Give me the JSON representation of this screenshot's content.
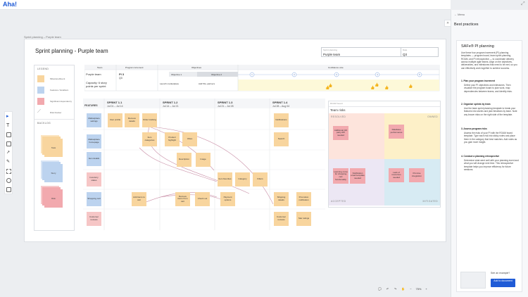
{
  "app": {
    "logo": "Aha!",
    "expand_icon": "expand-icon"
  },
  "breadcrumb": "Sprint planning – Purple team",
  "board": {
    "title": "Sprint planning - Purple team",
    "fields": [
      {
        "label": "Sprint planning",
        "value": "Purple team"
      },
      {
        "label": "Date",
        "value": "Q3"
      }
    ]
  },
  "legend": {
    "heading": "LEGEND",
    "items": [
      "Milestone/Event",
      "Features / Enablers",
      "Significant dependency",
      "Risk blocker"
    ],
    "backlog_heading": "BACKLOG",
    "backlog": [
      "Task",
      "Story",
      "Risk"
    ]
  },
  "pi_table": {
    "team_hdr": "Team",
    "inc_hdr": "Program increment",
    "obj_hdr": "Objectives",
    "conf_hdr": "Confidence vote",
    "team": "Purple team",
    "pi": "PI 3",
    "pi_sub": "Q3",
    "capacity": "Capacity: 6 story points per sprint",
    "obj1": "Objective 1",
    "obj2": "Objective 2",
    "obj1_text": "Launch marketplace",
    "obj2_text": "Add 50+ partners",
    "votes": [
      "1",
      "2",
      "3",
      "4",
      "5"
    ]
  },
  "features_label": "FEATURES",
  "sprints": [
    {
      "name": "SPRINT 1.1",
      "dates": "Jul 01 – Jul 14"
    },
    {
      "name": "SPRINT 1.2",
      "dates": "Jul 14 – Jul 21"
    },
    {
      "name": "SPRINT 1.3",
      "dates": "Jul 21 – Jul 28"
    },
    {
      "name": "SPRINT 1.4",
      "dates": "Jul 28 – Aug 04"
    }
  ],
  "features": [
    "Marketplace settings",
    "Marketplace homepage",
    "Item details",
    "Inventory status",
    "Shopping cart",
    "Customer reviews"
  ],
  "stickies": [
    "User profile",
    "Remove details",
    "Order tracking",
    "Notifications",
    "Item categories",
    "Product highlight",
    "Video",
    "Search",
    "Description",
    "Image",
    "Item favorites",
    "Category",
    "Filters",
    "Add items to cart",
    "Remove items from cart",
    "Check out",
    "Payment options",
    "Shipping details",
    "Promotion notification",
    "Customer reviews",
    "Star ratings"
  ],
  "roam": {
    "label": "ROAM board",
    "title": "Team risks",
    "resolved": "RESOLVED",
    "owned": "OWNED",
    "accepted": "ACCEPTED",
    "mitigated": "MITIGATED",
    "notes": [
      "Additional 3rd party API needed",
      "Database performance",
      "Learning curve for shopping cart functionality",
      "Notification email template needed",
      "Lack of resources needed",
      "Promise integration"
    ]
  },
  "right_panel": {
    "menu": "Menu",
    "heading": "Best practices",
    "card_title": "SAFe® PI planning",
    "intro": "Use these four program increment (PI) planning templates — program board, team sprint planning, ROAM, and PI retrospective — to coordinate delivery across multiple agile teams. Align on the objectives, deliverables, and milestones that need to be met, so you can effectively work together to achieve success.",
    "steps": [
      {
        "title": "1. Plan your program increment",
        "body": "Define your PI objectives and milestones. Then visualize the program board to plan work, map dependencies between teams, and identify risks."
      },
      {
        "title": "2. Organize sprints by team",
        "body": "Use the team sprint planning template to break your features into stories and plan iterations by team. Note any known risks on the right side of the template."
      },
      {
        "title": "3. Assess program risks",
        "body": "Assess the risks of your PI with the ROAM board template. Type each risk into sticky notes and place them in the category that best matches. Add notes as you gain more insight."
      },
      {
        "title": "4. Conduct a planning retrospective",
        "body": "Determine what went well with your planning event and what you will change next time. This retrospective template helps you improve efficiency for future sessions."
      }
    ],
    "example": "See an example?",
    "add_button": "Add to document"
  },
  "zoom": {
    "level": "75%"
  }
}
